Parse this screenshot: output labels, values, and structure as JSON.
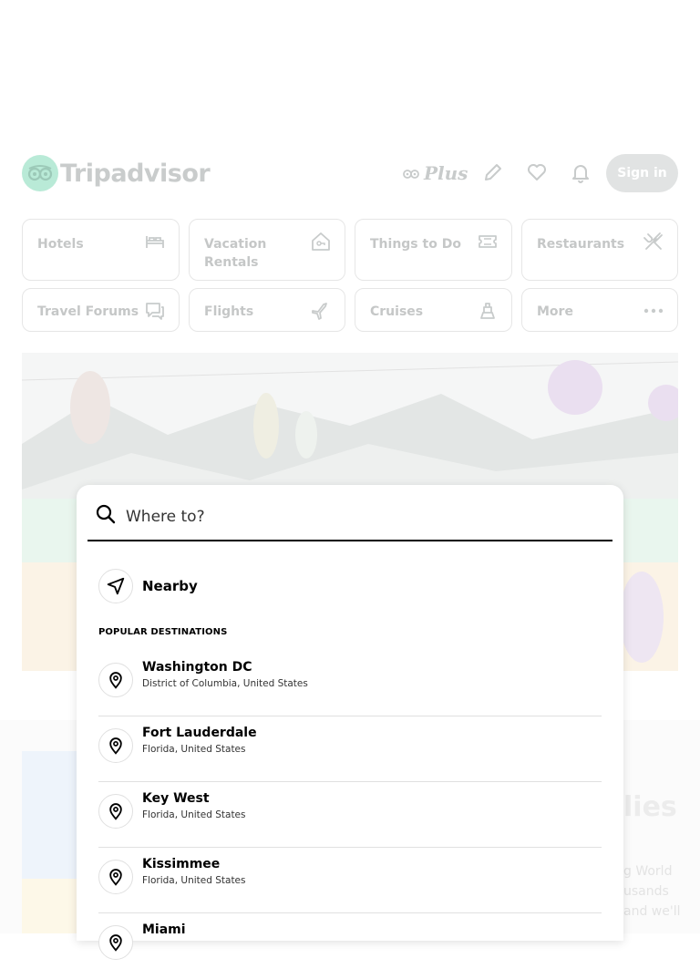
{
  "header": {
    "logo_text": "Tripadvisor",
    "plus_label": "Plus",
    "signin_label": "Sign in",
    "icons": [
      "owl-logo-icon",
      "pencil-icon",
      "heart-icon",
      "bell-icon"
    ]
  },
  "categories": [
    {
      "label": "Hotels",
      "icon": "bed-icon"
    },
    {
      "label": "Vacation Rentals",
      "icon": "house-key-icon"
    },
    {
      "label": "Things to Do",
      "icon": "ticket-icon"
    },
    {
      "label": "Restaurants",
      "icon": "fork-knife-icon"
    },
    {
      "label": "Travel Forums",
      "icon": "chat-bubbles-icon"
    },
    {
      "label": "Flights",
      "icon": "plane-icon"
    },
    {
      "label": "Cruises",
      "icon": "ship-icon"
    },
    {
      "label": "More",
      "icon": "more-dots-icon"
    }
  ],
  "search": {
    "placeholder": "Where to?",
    "nearby_label": "Nearby",
    "popular_heading": "POPULAR DESTINATIONS",
    "destinations": [
      {
        "name": "Washington DC",
        "region": "District of Columbia, United States"
      },
      {
        "name": "Fort Lauderdale",
        "region": "Florida, United States"
      },
      {
        "name": "Key West",
        "region": "Florida, United States"
      },
      {
        "name": "Kissimmee",
        "region": "Florida, United States"
      },
      {
        "name": "Miami",
        "region": ""
      }
    ]
  },
  "background": {
    "partial_title": "lies",
    "partial_lines": [
      "g World",
      "usands",
      "and we'll"
    ]
  },
  "colors": {
    "brand_green": "#34e0a1",
    "faded_text": "#c5c7c7",
    "signin_bg": "#e1e3e3"
  }
}
